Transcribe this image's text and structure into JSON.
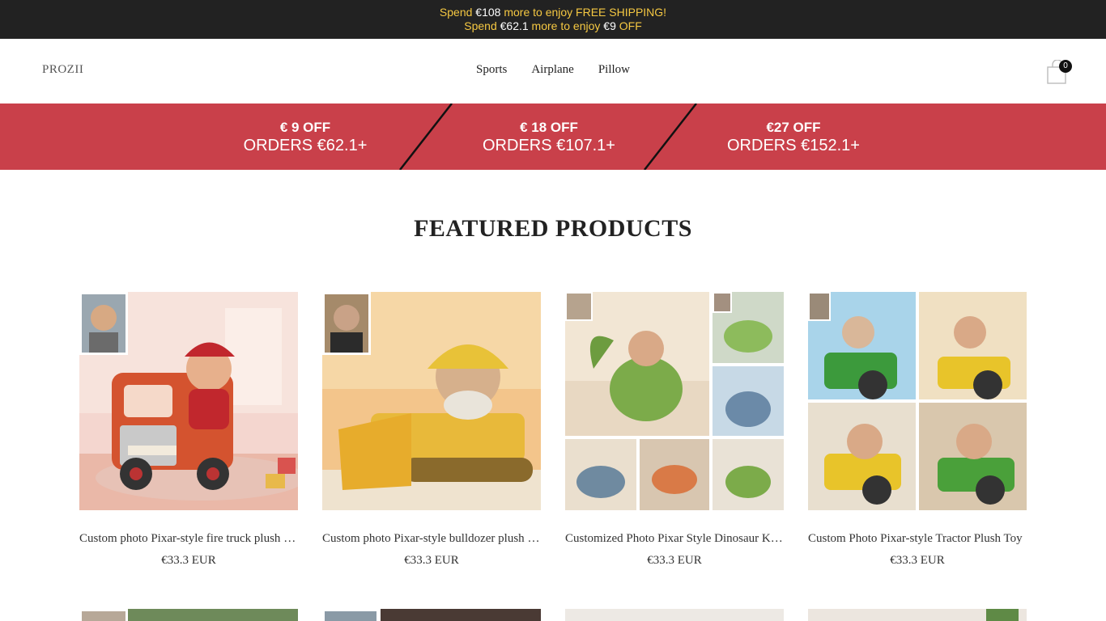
{
  "announcement": {
    "line1": {
      "pre": "Spend ",
      "amount": "€108",
      "post": " more to enjoy FREE SHIPPING!"
    },
    "line2": {
      "pre": "Spend ",
      "amount": "€62.1",
      "mid": " more to enjoy ",
      "discount": "€9",
      "post": " OFF"
    }
  },
  "header": {
    "logo": "PROZII",
    "nav": [
      "Sports",
      "Airplane",
      "Pillow"
    ],
    "cart_count": "0",
    "cart_icon": "shopping-bag-icon"
  },
  "promo": {
    "tiers": [
      {
        "off": "€ 9 OFF",
        "orders": "ORDERS €62.1+"
      },
      {
        "off": "€ 18 OFF",
        "orders": "ORDERS €107.1+"
      },
      {
        "off": "€27 OFF",
        "orders": "ORDERS €152.1+"
      }
    ],
    "background": "#c9404a"
  },
  "featured": {
    "title": "FEATURED PRODUCTS",
    "products": [
      {
        "title": "Custom photo Pixar-style fire truck plush toy",
        "price": "€33.3 EUR"
      },
      {
        "title": "Custom photo Pixar-style bulldozer plush toy",
        "price": "€33.3 EUR"
      },
      {
        "title": "Customized Photo Pixar Style Dinosaur Knight Plush",
        "price": "€33.3 EUR"
      },
      {
        "title": "Custom Photo Pixar-style Tractor Plush Toy",
        "price": "€33.3 EUR"
      }
    ]
  },
  "colors": {
    "announce_bg": "#222222",
    "announce_text": "#f5c842",
    "promo_bg": "#c9404a"
  }
}
